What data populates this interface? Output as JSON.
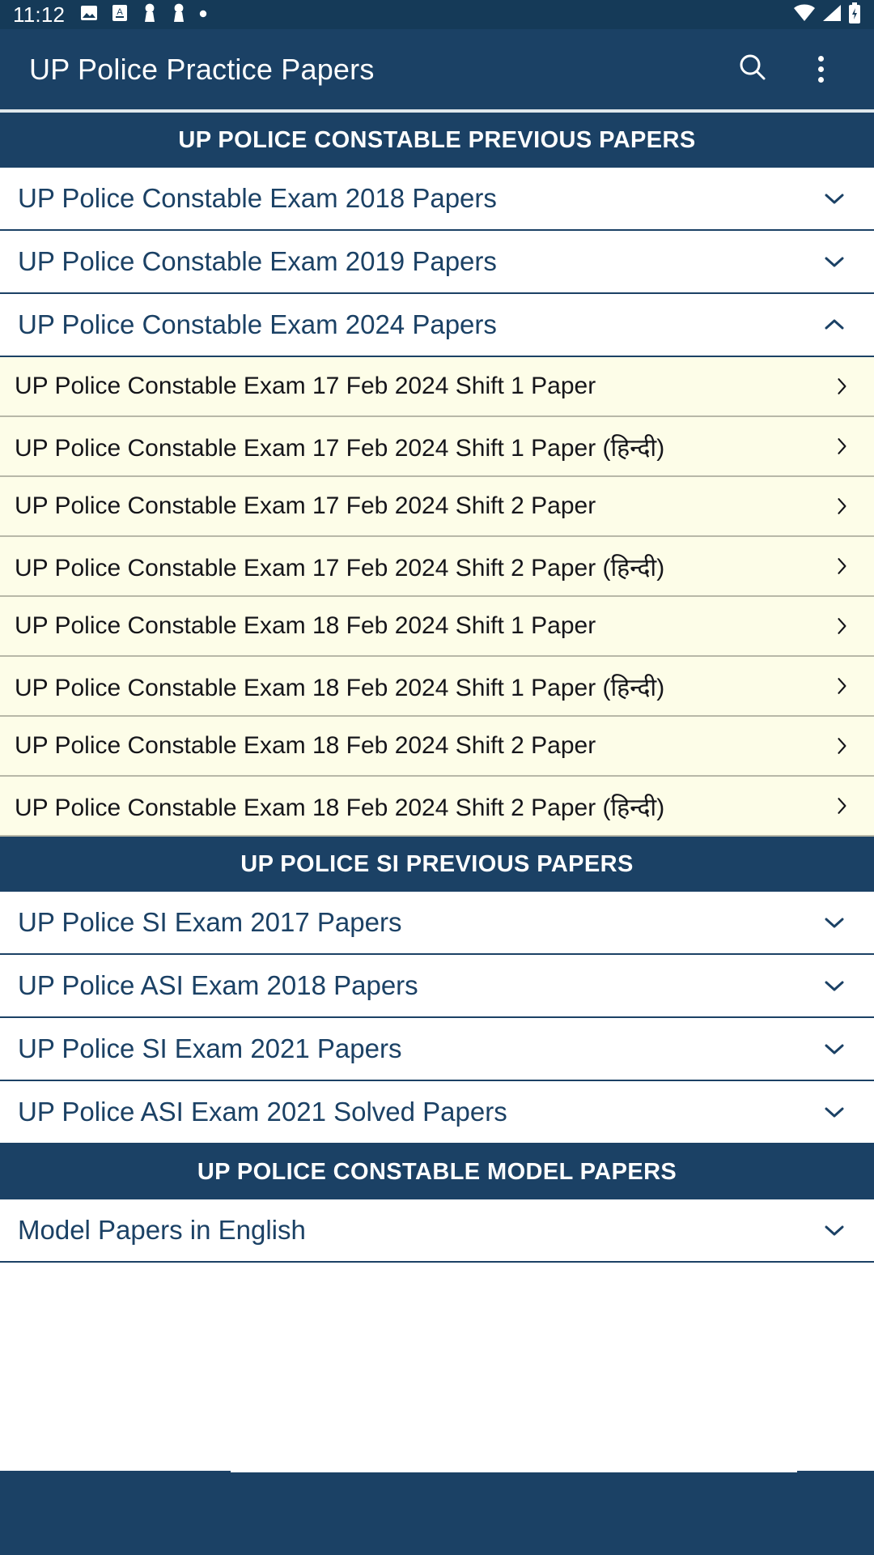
{
  "status_bar": {
    "time": "11:12",
    "left_icons": [
      "image-icon",
      "screenshot-icon",
      "chess-pawn-icon",
      "chess-pawn-icon",
      "dot-icon"
    ],
    "right_icons": [
      "wifi-icon",
      "signal-icon",
      "battery-icon"
    ]
  },
  "app_bar": {
    "title": "UP Police Practice Papers",
    "search_icon": "search-icon",
    "overflow_icon": "more-vertical-icon"
  },
  "colors": {
    "brand_navy": "#1b4165",
    "status_navy": "#153a58",
    "sub_item_cream": "#fdfde8",
    "link_text": "#1b4165",
    "sub_text": "#15151a",
    "divider_navy": "#1b4165",
    "divider_gray": "#b8b8a8"
  },
  "sections": [
    {
      "id": "constable-previous-papers",
      "header": "UP POLICE CONSTABLE PREVIOUS PAPERS",
      "items": [
        {
          "label": "UP Police Constable Exam 2018 Papers",
          "expanded": false,
          "chevron": "chevron-down-icon",
          "children": []
        },
        {
          "label": "UP Police Constable Exam 2019 Papers",
          "expanded": false,
          "chevron": "chevron-down-icon",
          "children": []
        },
        {
          "label": "UP Police Constable Exam 2024 Papers",
          "expanded": true,
          "chevron": "chevron-up-icon",
          "children": [
            {
              "label": "UP Police Constable Exam 17 Feb 2024 Shift 1 Paper",
              "chevron": "chevron-right-icon"
            },
            {
              "label": "UP Police Constable Exam 17 Feb 2024 Shift 1 Paper (हिन्दी)",
              "chevron": "chevron-right-icon"
            },
            {
              "label": "UP Police Constable Exam 17 Feb 2024 Shift 2 Paper",
              "chevron": "chevron-right-icon"
            },
            {
              "label": "UP Police Constable Exam 17 Feb 2024 Shift 2 Paper (हिन्दी)",
              "chevron": "chevron-right-icon"
            },
            {
              "label": "UP Police Constable Exam 18 Feb 2024 Shift 1 Paper",
              "chevron": "chevron-right-icon"
            },
            {
              "label": "UP Police Constable Exam 18 Feb 2024 Shift 1 Paper (हिन्दी)",
              "chevron": "chevron-right-icon"
            },
            {
              "label": "UP Police Constable Exam 18 Feb 2024 Shift 2 Paper",
              "chevron": "chevron-right-icon"
            },
            {
              "label": "UP Police Constable Exam 18 Feb 2024 Shift 2 Paper (हिन्दी)",
              "chevron": "chevron-right-icon"
            }
          ]
        }
      ]
    },
    {
      "id": "si-previous-papers",
      "header": "UP POLICE SI PREVIOUS PAPERS",
      "items": [
        {
          "label": "UP Police SI Exam 2017 Papers",
          "expanded": false,
          "chevron": "chevron-down-icon",
          "children": []
        },
        {
          "label": "UP Police ASI Exam 2018 Papers",
          "expanded": false,
          "chevron": "chevron-down-icon",
          "children": []
        },
        {
          "label": "UP Police SI Exam 2021 Papers",
          "expanded": false,
          "chevron": "chevron-down-icon",
          "children": []
        },
        {
          "label": "UP Police ASI Exam 2021 Solved Papers",
          "expanded": false,
          "chevron": "chevron-down-icon",
          "children": []
        }
      ]
    },
    {
      "id": "constable-model-papers",
      "header": "UP POLICE CONSTABLE MODEL PAPERS",
      "items": [
        {
          "label": "Model Papers in English",
          "expanded": false,
          "chevron": "chevron-down-icon",
          "children": []
        }
      ]
    }
  ]
}
